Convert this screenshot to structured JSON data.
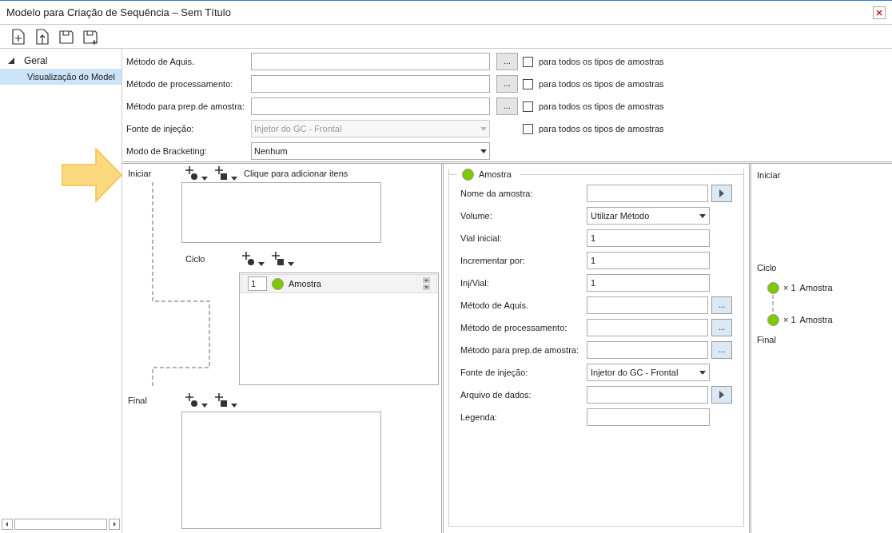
{
  "window": {
    "title": "Modelo para Criação de Sequência – Sem Título"
  },
  "sidebar": {
    "tree": [
      {
        "label": "Geral",
        "expanded": true,
        "selected": false,
        "children": [
          {
            "label": "Visualização do Model",
            "selected": true
          }
        ]
      }
    ]
  },
  "top_form": {
    "rows": [
      {
        "kind": "browse",
        "label": "Método de Aquis.",
        "browse_label": "...",
        "checkbox_label": "para todos os tipos de amostras",
        "checked": false
      },
      {
        "kind": "browse",
        "label": "Método de processamento:",
        "browse_label": "...",
        "checkbox_label": "para todos os tipos de amostras",
        "checked": false
      },
      {
        "kind": "browse",
        "label": "Método para prep.de amostra:",
        "browse_label": "...",
        "checkbox_label": "para todos os tipos de amostras",
        "checked": false
      },
      {
        "kind": "dropdown",
        "label": "Fonte de injeção:",
        "value": "Injetor do GC - Frontal",
        "checkbox_label": "para todos os tipos de amostras",
        "checked": false,
        "disabled": true
      },
      {
        "kind": "dropdown",
        "label": "Modo de Bracketing:",
        "value": "Nenhum",
        "disabled": false
      }
    ]
  },
  "sequence": {
    "sections": [
      {
        "kind": "start",
        "label": "Iniciar",
        "hint": "Clique para adicionar itens"
      },
      {
        "kind": "cycle",
        "label": "Ciclo",
        "items": [
          {
            "count": "1",
            "name": "Amostra",
            "color": "#7ec800"
          }
        ]
      },
      {
        "kind": "end",
        "label": "Final"
      }
    ]
  },
  "sample_panel": {
    "title": "Amostra",
    "color": "#7ec800",
    "fields": [
      {
        "kind": "run",
        "label": "Nome da amostra:"
      },
      {
        "kind": "dropdown",
        "label": "Volume:",
        "value": "Utilizar Método"
      },
      {
        "kind": "text",
        "label": "Vial inicial:",
        "value": "1"
      },
      {
        "kind": "text",
        "label": "Incrementar por:",
        "value": "1"
      },
      {
        "kind": "text",
        "label": "Inj/Vial:",
        "value": "1"
      },
      {
        "kind": "browse",
        "label": "Método de Aquis.",
        "browse_label": "..."
      },
      {
        "kind": "browse",
        "label": "Método de processamento:",
        "browse_label": "..."
      },
      {
        "kind": "browse",
        "label": "Método para prep.de amostra:",
        "browse_label": "..."
      },
      {
        "kind": "dropdown",
        "label": "Fonte de injeção:",
        "value": "Injetor do GC - Frontal"
      },
      {
        "kind": "run",
        "label": "Arquivo de dados:"
      },
      {
        "kind": "text",
        "label": "Legenda:"
      }
    ]
  },
  "summary": {
    "sections": [
      {
        "label": "Iniciar"
      },
      {
        "label": "Ciclo",
        "items": [
          {
            "count": "× 1",
            "name": "Amostra",
            "color": "#7ec800"
          },
          {
            "count": "× 1",
            "name": "Amostra",
            "color": "#7ec800"
          }
        ]
      },
      {
        "label": "Final"
      }
    ]
  }
}
